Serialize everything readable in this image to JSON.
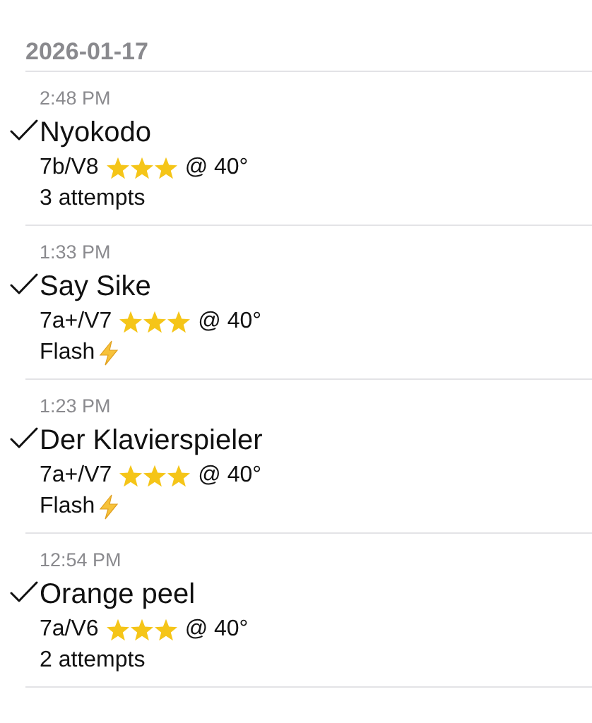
{
  "section": {
    "title": "2026-01-17"
  },
  "entries": [
    {
      "time": "2:48 PM",
      "checked": true,
      "name": "Nyokodo",
      "grade": "7b/V8",
      "stars": 3,
      "angle": "@ 40°",
      "note": "3 attempts",
      "flash": false
    },
    {
      "time": "1:33 PM",
      "checked": true,
      "name": "Say Sike",
      "grade": "7a+/V7",
      "stars": 3,
      "angle": "@ 40°",
      "note": "Flash",
      "flash": true
    },
    {
      "time": "1:23 PM",
      "checked": true,
      "name": "Der Klavierspieler",
      "grade": "7a+/V7",
      "stars": 3,
      "angle": "@ 40°",
      "note": "Flash",
      "flash": true
    },
    {
      "time": "12:54 PM",
      "checked": true,
      "name": "Orange peel",
      "grade": "7a/V6",
      "stars": 3,
      "angle": "@ 40°",
      "note": "2 attempts",
      "flash": false
    }
  ]
}
